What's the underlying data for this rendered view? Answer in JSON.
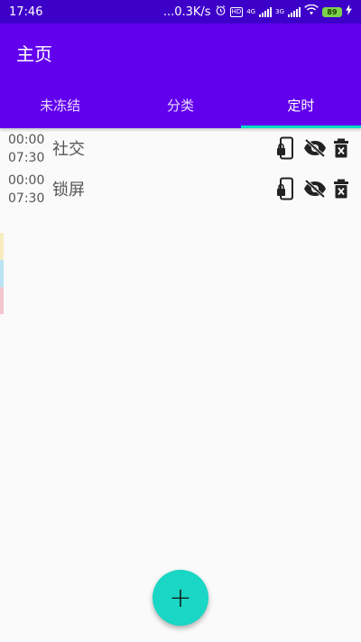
{
  "status_bar": {
    "time": "17:46",
    "net_speed": "...0.3K/s",
    "alarm_icon": "alarm-clock-icon",
    "hd_badge": "HD",
    "network_4g": "4G",
    "network_3g": "3G",
    "battery": "89"
  },
  "app_bar": {
    "title": "主页"
  },
  "tabs": [
    {
      "label": "未冻结",
      "active": false
    },
    {
      "label": "分类",
      "active": false
    },
    {
      "label": "定时",
      "active": true
    }
  ],
  "schedules": [
    {
      "start": "00:00",
      "end": "07:30",
      "name": "社交"
    },
    {
      "start": "00:00",
      "end": "07:30",
      "name": "锁屏"
    }
  ],
  "row_action_icons": [
    "phone-lock-icon",
    "eye-off-icon",
    "delete-icon"
  ],
  "fab": {
    "label": "+"
  },
  "colors": {
    "status_bar": "#3d00c9",
    "primary": "#6200ee",
    "accent": "#03dac6",
    "fab": "#1ad6c4",
    "background": "#fafafa",
    "side_strips": [
      "#f7ebc0",
      "#b9e2f2",
      "#f2c5d1"
    ]
  }
}
